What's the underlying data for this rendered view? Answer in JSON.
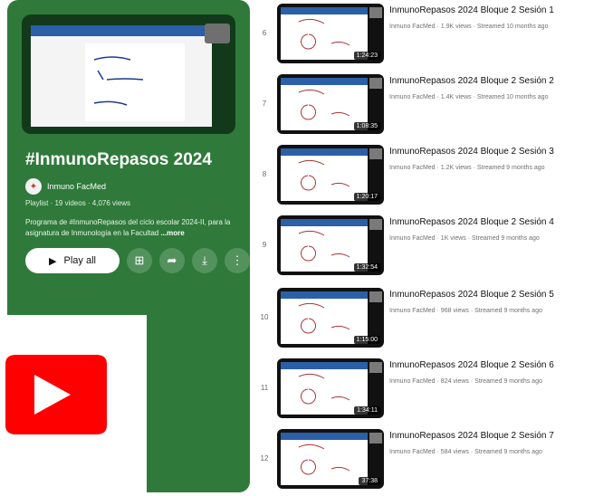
{
  "playlist": {
    "title": "#InmunoRepasos 2024",
    "channel": "Inmuno FacMed",
    "meta": "Playlist · 19 videos · 4,076 views",
    "description": "Programa de #InmunoRepasos del ciclo escolar 2024-II, para la asignatura de Inmunología en la Facultad",
    "more": "...more",
    "play_all": "Play all",
    "icons": [
      "save-to-library-icon",
      "share-icon",
      "download-icon",
      "more-vert-icon"
    ]
  },
  "colors": {
    "sidebar": "#2f7a3a",
    "youtube_red": "#ff0000"
  },
  "videos": [
    {
      "index": "6",
      "title": "InmunoRepasos 2024 Bloque 2 Sesión 1",
      "meta": "Inmuno FacMed · 1.9K views · Streamed 10 months ago",
      "duration": "1:24:23"
    },
    {
      "index": "7",
      "title": "InmunoRepasos 2024 Bloque 2 Sesión 2",
      "meta": "Inmuno FacMed · 1.4K views · Streamed 10 months ago",
      "duration": "1:08:35"
    },
    {
      "index": "8",
      "title": "InmunoRepasos 2024 Bloque 2 Sesión 3",
      "meta": "Inmuno FacMed · 1.2K views · Streamed 9 months ago",
      "duration": "1:20:17"
    },
    {
      "index": "9",
      "title": "InmunoRepasos 2024 Bloque 2 Sesión 4",
      "meta": "Inmuno FacMed · 1K views · Streamed 9 months ago",
      "duration": "1:32:54"
    },
    {
      "index": "10",
      "title": "InmunoRepasos 2024 Bloque 2 Sesión 5",
      "meta": "Inmuno FacMed · 968 views · Streamed 9 months ago",
      "duration": "1:15:00"
    },
    {
      "index": "11",
      "title": "InmunoRepasos 2024 Bloque 2 Sesión 6",
      "meta": "Inmuno FacMed · 824 views · Streamed 9 months ago",
      "duration": "1:34:11"
    },
    {
      "index": "12",
      "title": "InmunoRepasos 2024 Bloque 2 Sesión 7",
      "meta": "Inmuno FacMed · 584 views · Streamed 9 months ago",
      "duration": "37:38"
    }
  ]
}
